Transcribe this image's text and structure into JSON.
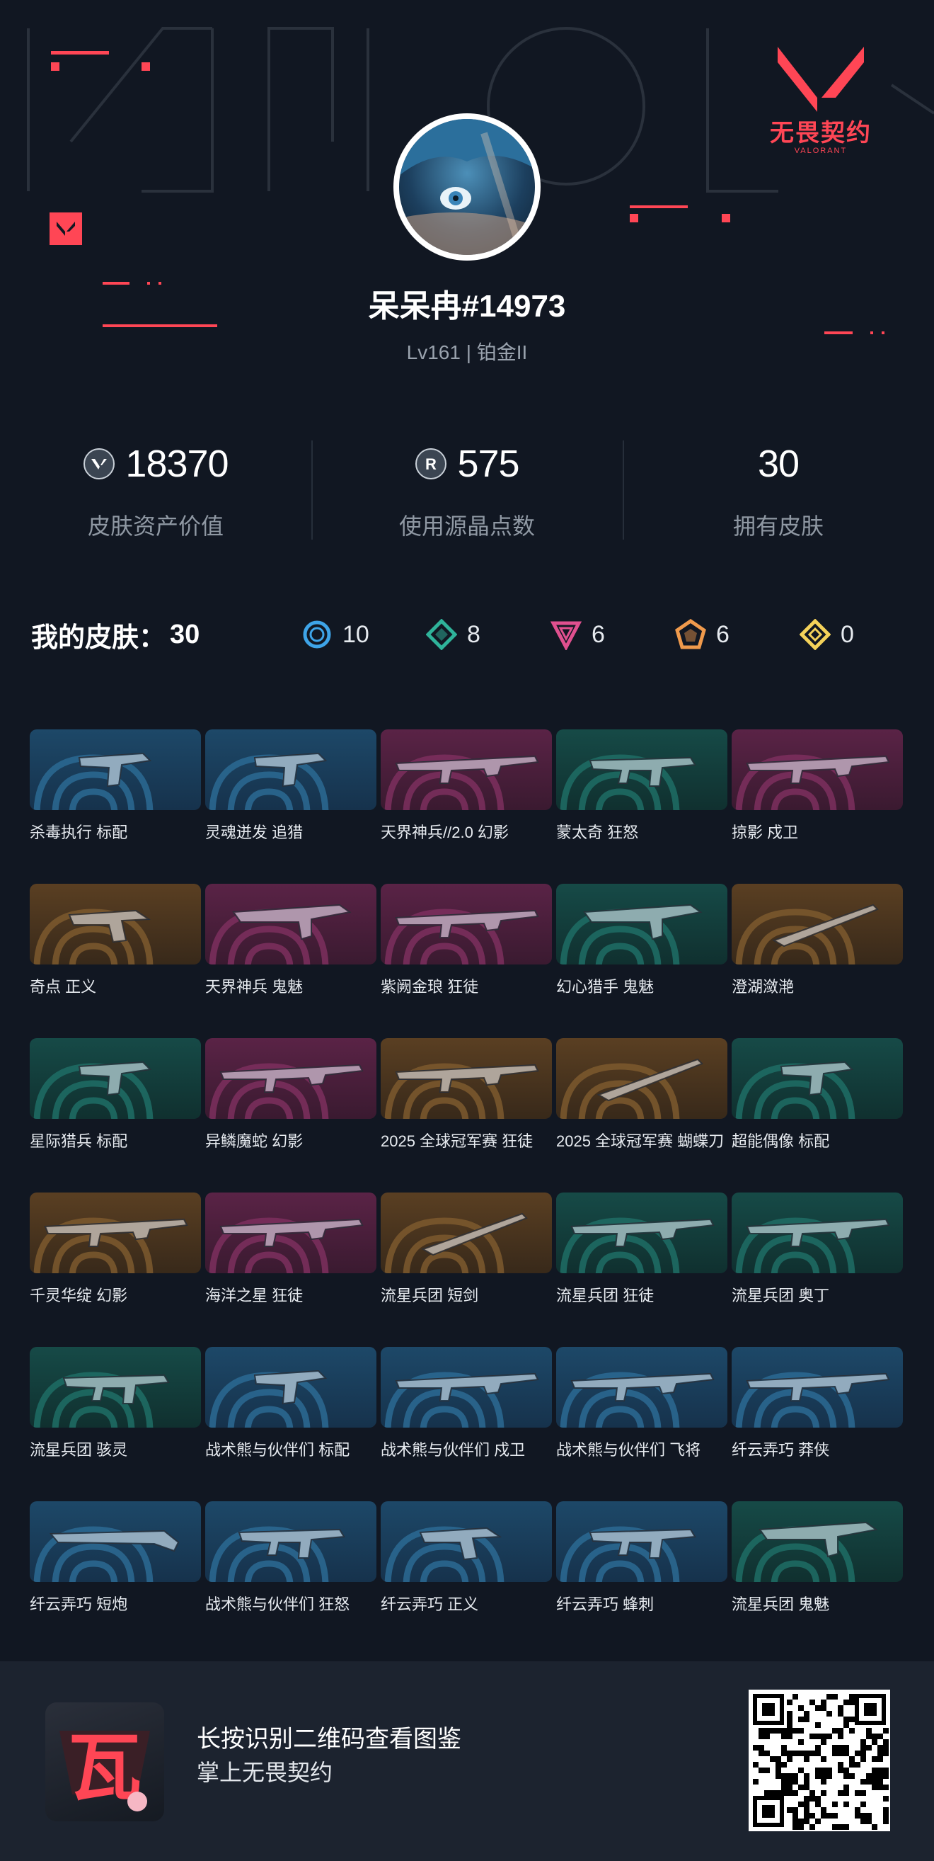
{
  "brand": {
    "title": "无畏契约",
    "subtitle": "VALORANT"
  },
  "player": {
    "name": "呆呆冉#14973",
    "subtitle": "Lv161 | 铂金II"
  },
  "stats": [
    {
      "icon": "valorant-points-icon",
      "value": "18370",
      "label": "皮肤资产价值"
    },
    {
      "icon": "radianite-icon",
      "value": "575",
      "label": "使用源晶点数"
    },
    {
      "icon": "",
      "value": "30",
      "label": "拥有皮肤"
    }
  ],
  "summary": {
    "title": "我的皮肤：",
    "count": "30",
    "tiers": [
      {
        "icon": "select-tier-icon",
        "color": "#3ea4e8",
        "count": "10"
      },
      {
        "icon": "deluxe-tier-icon",
        "color": "#2fb39a",
        "count": "8"
      },
      {
        "icon": "premium-tier-icon",
        "color": "#e0508f",
        "count": "6"
      },
      {
        "icon": "exclusive-tier-icon",
        "color": "#f09a4c",
        "count": "6"
      },
      {
        "icon": "ultra-tier-icon",
        "color": "#f4d25a",
        "count": "0"
      }
    ]
  },
  "skins": [
    {
      "name": "杀毒执行 标配",
      "tier": "blue",
      "weapon": "pistol"
    },
    {
      "name": "灵魂迸发 追猎",
      "tier": "blue",
      "weapon": "pistol"
    },
    {
      "name": "天界神兵//2.0 幻影",
      "tier": "purple",
      "weapon": "rifle"
    },
    {
      "name": "蒙太奇 狂怒",
      "tier": "green",
      "weapon": "smg"
    },
    {
      "name": "掠影 戍卫",
      "tier": "purple",
      "weapon": "rifle"
    },
    {
      "name": "奇点 正义",
      "tier": "orange",
      "weapon": "revolver"
    },
    {
      "name": "天界神兵 鬼魅",
      "tier": "purple",
      "weapon": "pistol-long"
    },
    {
      "name": "紫阙金琅 狂徒",
      "tier": "purple",
      "weapon": "rifle"
    },
    {
      "name": "幻心猎手 鬼魅",
      "tier": "green",
      "weapon": "pistol-long"
    },
    {
      "name": "澄湖潋滟",
      "tier": "orange",
      "weapon": "melee"
    },
    {
      "name": "星际猎兵 标配",
      "tier": "green",
      "weapon": "pistol"
    },
    {
      "name": "异鳞魔蛇 幻影",
      "tier": "purple",
      "weapon": "rifle"
    },
    {
      "name": "2025 全球冠军赛 狂徒",
      "tier": "orange",
      "weapon": "rifle"
    },
    {
      "name": "2025 全球冠军赛 蝴蝶刀",
      "tier": "orange",
      "weapon": "melee"
    },
    {
      "name": "超能偶像 标配",
      "tier": "green",
      "weapon": "pistol"
    },
    {
      "name": "千灵华绽 幻影",
      "tier": "orange",
      "weapon": "rifle"
    },
    {
      "name": "海洋之星 狂徒",
      "tier": "purple",
      "weapon": "rifle"
    },
    {
      "name": "流星兵团 短剑",
      "tier": "orange",
      "weapon": "melee"
    },
    {
      "name": "流星兵团 狂徒",
      "tier": "green",
      "weapon": "rifle"
    },
    {
      "name": "流星兵团 奥丁",
      "tier": "green",
      "weapon": "rifle"
    },
    {
      "name": "流星兵团 骇灵",
      "tier": "green",
      "weapon": "smg"
    },
    {
      "name": "战术熊与伙伴们 标配",
      "tier": "blue",
      "weapon": "pistol"
    },
    {
      "name": "战术熊与伙伴们 戍卫",
      "tier": "blue",
      "weapon": "rifle"
    },
    {
      "name": "战术熊与伙伴们 飞将",
      "tier": "blue",
      "weapon": "rifle"
    },
    {
      "name": "纤云弄巧 莽侠",
      "tier": "blue",
      "weapon": "rifle"
    },
    {
      "name": "纤云弄巧 短炮",
      "tier": "blue",
      "weapon": "shotgun"
    },
    {
      "name": "战术熊与伙伴们 狂怒",
      "tier": "blue",
      "weapon": "smg"
    },
    {
      "name": "纤云弄巧 正义",
      "tier": "blue",
      "weapon": "revolver"
    },
    {
      "name": "纤云弄巧 蜂刺",
      "tier": "blue",
      "weapon": "smg"
    },
    {
      "name": "流星兵团 鬼魅",
      "tier": "green",
      "weapon": "pistol-long"
    }
  ],
  "footer": {
    "line1": "长按识别二维码查看图鉴",
    "line2": "掌上无畏契约",
    "app_icon": "瓦"
  }
}
